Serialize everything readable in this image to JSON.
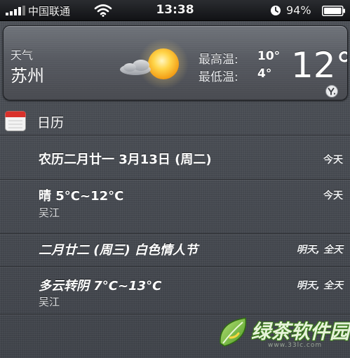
{
  "status_bar": {
    "carrier": "中国联通",
    "time": "13:38",
    "battery_percent": "94%",
    "icons": [
      "signal-icon",
      "wifi-icon",
      "alarm-clock-icon",
      "battery-icon"
    ]
  },
  "weather": {
    "label": "天气",
    "city": "苏州",
    "high_label": "最高温:",
    "high_value": "10°",
    "low_label": "最低温:",
    "low_value": "4°",
    "current_temp": "12°",
    "condition_icon": "sun-cloud-icon",
    "provider_icon": "yahoo-icon"
  },
  "calendar": {
    "title": "日历",
    "icon": "calendar-icon",
    "events": [
      {
        "title": "农历二月廿一 3月13日 (周二)",
        "subtitle": "",
        "when": "今天"
      },
      {
        "title": "晴 5°C~12°C",
        "subtitle": "吴江",
        "when": "今天"
      },
      {
        "title": "二月廿二 (周三)  白色情人节",
        "subtitle": "",
        "when": "明天, 全天"
      },
      {
        "title": "多云转阴 7°C~13°C",
        "subtitle": "吴江",
        "when": "明天, 全天"
      }
    ]
  },
  "watermark": {
    "text": "绿茶软件园",
    "url": "www.33lc.com"
  },
  "colors": {
    "background": "#41454c",
    "status_bar": "#111215",
    "sun": "#f6b21b",
    "battery_fill": "#ffffff",
    "watermark_green": "#3b7a1c"
  }
}
